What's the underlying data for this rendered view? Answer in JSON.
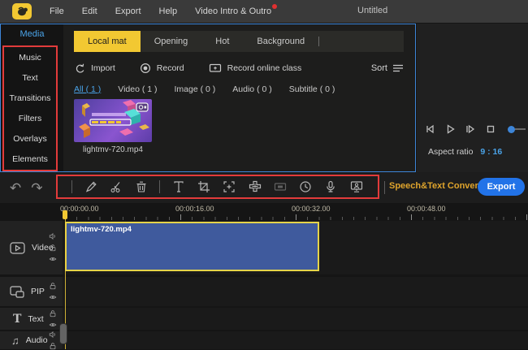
{
  "window": {
    "title": "Untitled"
  },
  "menubar": {
    "items": [
      {
        "label": "File"
      },
      {
        "label": "Edit"
      },
      {
        "label": "Export"
      },
      {
        "label": "Help"
      },
      {
        "label": "Video Intro & Outro"
      }
    ]
  },
  "sidebar": {
    "active_item": "Media",
    "items": [
      "Music",
      "Text",
      "Transitions",
      "Filters",
      "Overlays",
      "Elements"
    ]
  },
  "media": {
    "tabs": [
      "Local mat",
      "Opening",
      "Hot",
      "Background"
    ],
    "active_tab": "Local mat",
    "import_label": "Import",
    "record_label": "Record",
    "record_online_label": "Record online class",
    "sort_label": "Sort",
    "filters": [
      "All ( 1 )",
      "Video ( 1 )",
      "Image ( 0 )",
      "Audio ( 0 )",
      "Subtitle ( 0 )"
    ],
    "active_filter": "All ( 1 )",
    "clip_name": "lightmv-720.mp4"
  },
  "preview": {
    "aspect_ratio_label": "Aspect ratio",
    "aspect_ratio_value": "9 : 16"
  },
  "toolbar": {
    "undo": "↶",
    "redo": "↷",
    "speech_text_label": "Speech&Text Converter",
    "export_label": "Export"
  },
  "timeline": {
    "ruler_labels": [
      "00:00:00.00",
      "00:00:16.00",
      "00:00:32.00",
      "00:00:48.00"
    ],
    "tracks": [
      "Video",
      "PIP",
      "Text",
      "Audio"
    ],
    "clip_name": "lightmv-720.mp4"
  },
  "colors": {
    "accent_yellow": "#f2c832",
    "accent_blue": "#4aa3e8",
    "export_blue": "#2273e8",
    "highlight_red": "#e23b3b",
    "clip_blue": "#3f5a9d",
    "clip_border": "#e5d44a"
  }
}
